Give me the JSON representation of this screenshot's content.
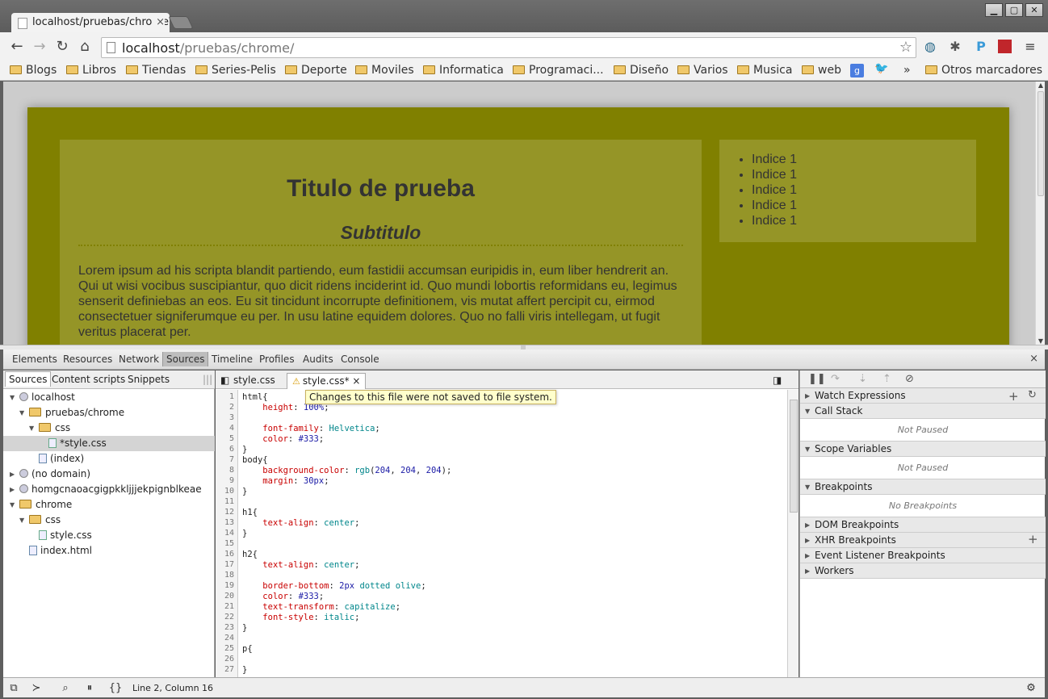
{
  "browser": {
    "tab_title": "localhost/pruebas/chrome",
    "url_host": "localhost",
    "url_path": "/pruebas/chrome/",
    "window_buttons": [
      "▁",
      "▢",
      "✕"
    ]
  },
  "bookmarks": [
    "Blogs",
    "Libros",
    "Tiendas",
    "Series-Pelis",
    "Deporte",
    "Moviles",
    "Informatica",
    "Programaci...",
    "Diseño",
    "Varios",
    "Musica",
    "web"
  ],
  "bookmarks_more": "»",
  "other_bookmarks": "Otros marcadores",
  "page": {
    "h1": "Titulo de prueba",
    "h2": "Subtitulo",
    "paragraph": "Lorem ipsum ad his scripta blandit partiendo, eum fastidii accumsan euripidis in, eum liber hendrerit an. Qui ut wisi vocibus suscipiantur, quo dicit ridens inciderint id. Quo mundi lobortis reformidans eu, legimus senserit definiebas an eos. Eu sit tincidunt incorrupte definitionem, vis mutat affert percipit cu, eirmod consectetuer signiferumque eu per. In usu latine equidem dolores. Quo no falli viris intellegam, ut fugit veritus placerat per.",
    "list": [
      "Indice 1",
      "Indice 1",
      "Indice 1",
      "Indice 1",
      "Indice 1"
    ],
    "colors": {
      "container": "#808000",
      "box": "#959527",
      "body": "#cccccc"
    }
  },
  "devtools": {
    "tabs": [
      "Elements",
      "Resources",
      "Network",
      "Sources",
      "Timeline",
      "Profiles",
      "Audits",
      "Console"
    ],
    "active_tab": "Sources",
    "close": "×",
    "navigator_tabs": [
      "Sources",
      "Content scripts",
      "Snippets"
    ],
    "tree": [
      {
        "label": "localhost",
        "type": "globe",
        "depth": 0,
        "open": true
      },
      {
        "label": "pruebas/chrome",
        "type": "folder",
        "depth": 1,
        "open": true
      },
      {
        "label": "css",
        "type": "folder",
        "depth": 2,
        "open": true
      },
      {
        "label": "*style.css",
        "type": "doc",
        "depth": 3,
        "selected": true
      },
      {
        "label": "(index)",
        "type": "html",
        "depth": 2
      },
      {
        "label": "(no domain)",
        "type": "globe",
        "depth": 0,
        "open": false
      },
      {
        "label": "homgcnaoacgigpkkljjjekpignblkeae",
        "type": "globe",
        "depth": 0,
        "open": false
      },
      {
        "label": "chrome",
        "type": "folder",
        "depth": 0,
        "open": true
      },
      {
        "label": "css",
        "type": "folder",
        "depth": 1,
        "open": true
      },
      {
        "label": "style.css",
        "type": "doc",
        "depth": 2
      },
      {
        "label": "index.html",
        "type": "html",
        "depth": 1
      }
    ],
    "editor_tabs": [
      {
        "label": "style.css",
        "modified": false
      },
      {
        "label": "style.css*",
        "modified": true
      }
    ],
    "tooltip": "Changes to this file were not saved to file system.",
    "code_lines": [
      "html{",
      "    height: 100%;",
      "",
      "    font-family: Helvetica;",
      "    color: #333;",
      "}",
      "body{",
      "    background-color: rgb(204, 204, 204);",
      "    margin: 30px;",
      "}",
      "",
      "h1{",
      "    text-align: center;",
      "}",
      "",
      "h2{",
      "    text-align: center;",
      "",
      "    border-bottom: 2px dotted olive;",
      "    color: #333;",
      "    text-transform: capitalize;",
      "    font-style: italic;",
      "}",
      "",
      "p{",
      "",
      "}"
    ],
    "sidebar": {
      "sections": [
        {
          "label": "Watch Expressions",
          "open": false,
          "empty": null
        },
        {
          "label": "Call Stack",
          "open": true,
          "empty": "Not Paused"
        },
        {
          "label": "Scope Variables",
          "open": true,
          "empty": "Not Paused"
        },
        {
          "label": "Breakpoints",
          "open": true,
          "empty": "No Breakpoints"
        },
        {
          "label": "DOM Breakpoints",
          "open": false,
          "empty": null
        },
        {
          "label": "XHR Breakpoints",
          "open": false,
          "empty": null
        },
        {
          "label": "Event Listener Breakpoints",
          "open": false,
          "empty": null
        },
        {
          "label": "Workers",
          "open": false,
          "empty": null
        }
      ]
    },
    "status": "Line 2, Column 16"
  }
}
